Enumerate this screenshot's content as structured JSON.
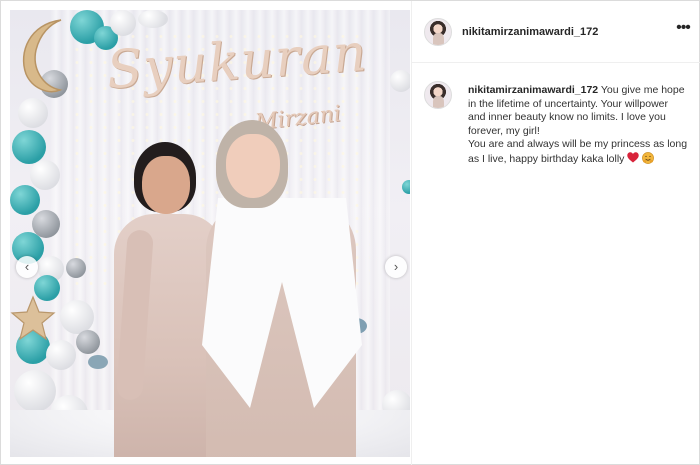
{
  "post": {
    "image_alt": "Mother and daughter in matching blush dresses posing in front of a Syukuran backdrop decorated with balloons",
    "banner_main": "Syukuran",
    "banner_sub": "Mirzani",
    "nav": {
      "prev": "‹",
      "next": "›"
    }
  },
  "header": {
    "username": "nikitamirzanimawardi_172",
    "more_label": "•••"
  },
  "caption": {
    "username": "nikitamirzanimawardi_172",
    "line1": "You give me hope in the lifetime of uncertainty. Your willpower and inner beauty know no limits. I love you forever, my girl!",
    "line2": "You are and always will be my princess as long as I live, happy birthday kaka lolly",
    "emojis": [
      "red-heart",
      "hugging-face"
    ]
  },
  "colors": {
    "teal_balloon": "#2b9fa6",
    "heart": "#d8243b",
    "hug_face": "#f2b63c",
    "text": "#262626"
  }
}
